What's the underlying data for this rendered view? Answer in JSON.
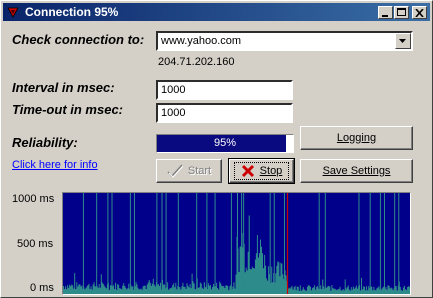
{
  "window": {
    "title": "Connection 95%"
  },
  "form": {
    "check_label": "Check connection to:",
    "host_value": "www.yahoo.com",
    "resolved_ip": "204.71.202.160",
    "interval_label": "Interval in msec:",
    "interval_value": "1000",
    "timeout_label": "Time-out in msec:",
    "timeout_value": "1000",
    "reliability_label": "Reliability:",
    "reliability_percent": 95,
    "reliability_text": "95%",
    "info_link": "Click here for info"
  },
  "buttons": {
    "logging": "Logging",
    "start": "Start",
    "stop": "Stop",
    "save": "Save Settings"
  },
  "chart_data": {
    "type": "area",
    "title": "",
    "xlabel": "",
    "ylabel": "",
    "y_tick_labels": [
      "1000 ms",
      "500 ms",
      "0 ms"
    ],
    "ylim": [
      0,
      1000
    ],
    "x_count": 340,
    "colors": {
      "background": "#00008b",
      "response": "#2e8b8b",
      "timeout": "#2e8b8b",
      "marker": "#cc0000"
    },
    "timeout_samples": [
      20,
      33,
      44,
      48,
      66,
      70,
      92,
      97,
      101,
      113,
      131,
      141,
      149,
      165,
      171,
      175,
      177,
      203,
      207,
      217,
      251,
      257,
      290,
      301,
      311,
      315,
      325,
      329
    ],
    "marker_sample": 220,
    "segments": [
      {
        "from": 0,
        "to": 170,
        "baseline_ms": 80
      },
      {
        "from": 170,
        "to": 198,
        "baseline_ms": 420
      },
      {
        "from": 198,
        "to": 220,
        "baseline_ms": 220
      },
      {
        "from": 220,
        "to": 340,
        "baseline_ms": 60
      }
    ]
  }
}
